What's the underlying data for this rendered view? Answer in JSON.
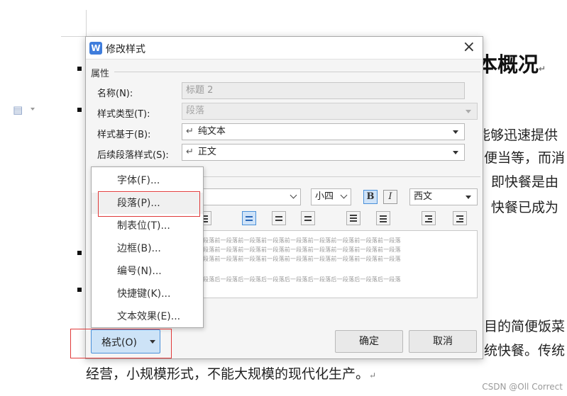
{
  "document": {
    "heading": "本概况",
    "lines": [
      "能够迅速提供",
      "便当等，而消",
      "即快餐是由",
      "快餐已成为",
      "目的简便饭菜",
      "统快餐。传统"
    ],
    "last_line": "经营，小规模形式，不能大规模的现代化生产。",
    "para_mark": "↵"
  },
  "watermark": "CSDN @Oll Correct",
  "dialog": {
    "title": "修改样式",
    "app_icon": "W",
    "close_glyph": "×",
    "properties_group": "属性",
    "fields": {
      "name_label": "名称(N):",
      "name_value": "标题 2",
      "style_type_label": "样式类型(T):",
      "style_type_value": "段落",
      "based_on_label": "样式基于(B):",
      "based_on_value": "纯文本",
      "following_label": "后续段落样式(S):",
      "following_value": "正文",
      "enter_glyph": "↵"
    },
    "font_toolbar": {
      "size_value": "小四",
      "bold": "B",
      "italic": "I",
      "script_value": "西文"
    },
    "preview": {
      "before_text": "段落前一段落前一段落前一段落前一段落前一段落前一段落前一段落前一段落",
      "after_text": "段落后一段落后一段落后一段落后一段落后一段落后一段落后一段落后一段落"
    },
    "ok_label": "确定",
    "cancel_label": "取消"
  },
  "format_menu": {
    "items": [
      "字体(F)...",
      "段落(P)...",
      "制表位(T)...",
      "边框(B)...",
      "编号(N)...",
      "快捷键(K)...",
      "文本效果(E)..."
    ],
    "button_label": "格式(O)"
  },
  "colors": {
    "accent": "#4a90d9",
    "highlight_box": "#e03a3a",
    "dialog_bg": "#f5f5f5"
  }
}
